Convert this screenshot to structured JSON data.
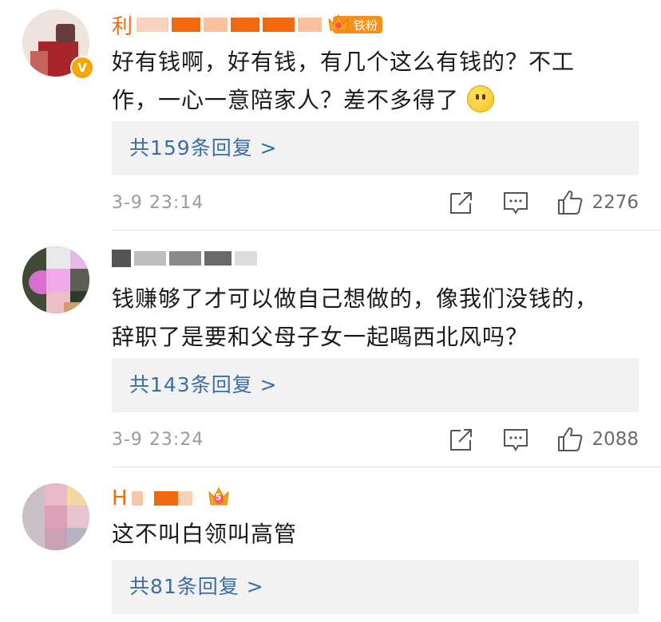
{
  "comments": [
    {
      "username": "利",
      "badge": "铁粉",
      "text_line1": "好有钱啊，好有钱，有几个这么有钱的？不工",
      "text_line2": "作，一心一意陪家人？差不多得了",
      "replies": "共159条回复 >",
      "time": "3-9 23:14",
      "likes": "2276"
    },
    {
      "username": "",
      "text_line1": "钱赚够了才可以做自己想做的，像我们没钱的，",
      "text_line2": "辞职了是要和父母子女一起喝西北风吗？",
      "replies": "共143条回复 >",
      "time": "3-9 23:24",
      "likes": "2088"
    },
    {
      "username": "H",
      "crown_level": "5",
      "text_line1": "这不叫白领叫高管",
      "replies": "共81条回复 >"
    }
  ],
  "colors": {
    "username": "#f26a10",
    "reply_link": "#3a6ea5",
    "badge_bg": "#f78f1d"
  }
}
